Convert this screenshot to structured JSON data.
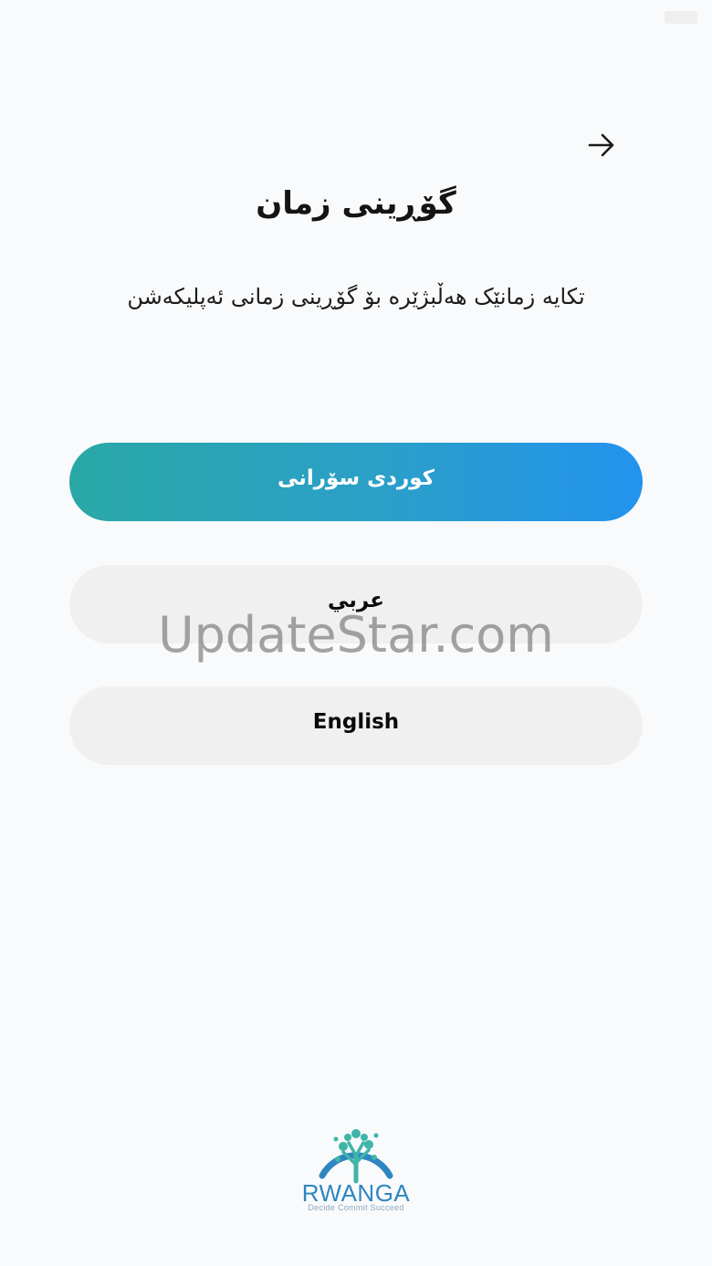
{
  "header": {
    "title": "گۆڕینی زمان",
    "subtitle": "تکایە زمانێک هەڵبژێرە بۆ گۆڕینی زمانی ئەپلیکەشن",
    "forward_icon": "arrow-right-icon"
  },
  "languages": {
    "kurdish": "كوردی سۆرانی",
    "arabic": "عربي",
    "english": "English",
    "selected": "kurdish",
    "gradient_start": "#2aa8a6",
    "gradient_end": "#2393ee"
  },
  "watermark": {
    "text": "UpdateStar.com"
  },
  "logo": {
    "name": "RWANGA",
    "tagline": "Decide Commit Succeed",
    "color": "#2e86c1",
    "icon": "tree-people-icon"
  }
}
